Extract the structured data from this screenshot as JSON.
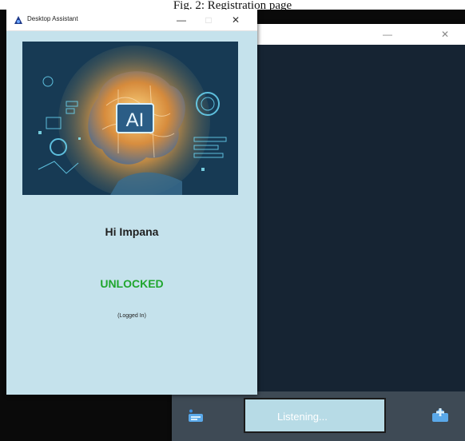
{
  "caption": "Fig. 2: Registration page",
  "front_window": {
    "title": "Desktop Assistant",
    "controls": {
      "minimize": "—",
      "maximize": "□",
      "close": "✕"
    },
    "hero": {
      "badge_text": "AI"
    },
    "greeting": "Hi Impana",
    "status": "UNLOCKED",
    "substatus": "(Logged In)",
    "status_color": "#20a62e",
    "background": "#c5e2ec"
  },
  "back_window": {
    "controls": {
      "minimize": "—",
      "close": "✕"
    },
    "background": "#162433",
    "bottom_bar": {
      "listening_label": "Listening...",
      "mic_icon": "mic-icon",
      "settings_icon": "settings-icon"
    }
  }
}
